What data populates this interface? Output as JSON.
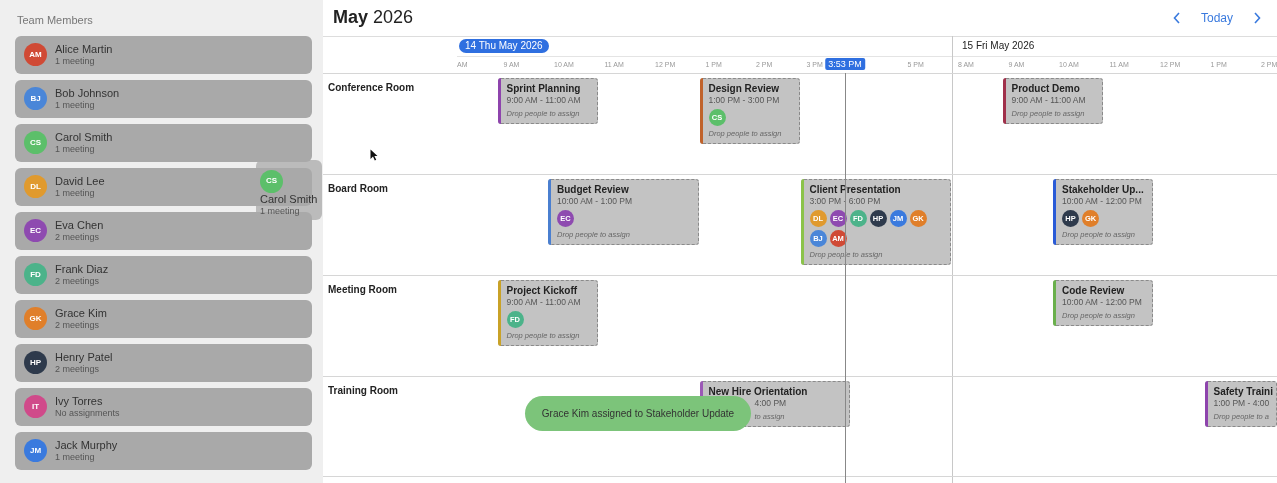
{
  "sidebar": {
    "title": "Team Members",
    "members": [
      {
        "initials": "AM",
        "name": "Alice Martin",
        "detail": "1 meeting",
        "color": "#d04a35"
      },
      {
        "initials": "BJ",
        "name": "Bob Johnson",
        "detail": "1 meeting",
        "color": "#4a86d8"
      },
      {
        "initials": "CS",
        "name": "Carol Smith",
        "detail": "1 meeting",
        "color": "#5cbf6a"
      },
      {
        "initials": "DL",
        "name": "David Lee",
        "detail": "1 meeting",
        "color": "#e09a2e"
      },
      {
        "initials": "EC",
        "name": "Eva Chen",
        "detail": "2 meetings",
        "color": "#8e4ab0"
      },
      {
        "initials": "FD",
        "name": "Frank Diaz",
        "detail": "2 meetings",
        "color": "#4cb38a"
      },
      {
        "initials": "GK",
        "name": "Grace Kim",
        "detail": "2 meetings",
        "color": "#e07f2a"
      },
      {
        "initials": "HP",
        "name": "Henry Patel",
        "detail": "2 meetings",
        "color": "#2e3a4c"
      },
      {
        "initials": "IT",
        "name": "Ivy Torres",
        "detail": "No assignments",
        "color": "#d04a8a"
      },
      {
        "initials": "JM",
        "name": "Jack Murphy",
        "detail": "1 meeting",
        "color": "#3a7ade"
      }
    ]
  },
  "drag_preview": {
    "initials": "CS",
    "name": "Carol Smith",
    "detail": "1 meeting",
    "color": "#5cbf6a"
  },
  "header": {
    "title": "**May** 2026",
    "today_label": "Today"
  },
  "days": [
    {
      "label": "14 Thu May 2026",
      "today": true,
      "hours": [
        "AM",
        "9 AM",
        "10 AM",
        "11 AM",
        "12 PM",
        "1 PM",
        "2 PM",
        "3 PM",
        "5 PM"
      ]
    },
    {
      "label": "15 Fri May 2026",
      "today": false,
      "hours": [
        "8 AM",
        "9 AM",
        "10 AM",
        "11 AM",
        "12 PM",
        "1 PM",
        "2 PM"
      ]
    }
  ],
  "now_marker": {
    "label": "3:53 PM"
  },
  "rooms": [
    {
      "name": "Conference Room",
      "days": [
        {
          "events": [
            {
              "kind": "card",
              "title": "Sprint Planning",
              "time": "9:00 AM - 11:00 AM",
              "color": "#8e44ad",
              "hint": "Drop people to assign"
            },
            {
              "kind": "card",
              "title": "Design Review",
              "time": "1:00 PM - 3:00 PM",
              "color": "#c0622b",
              "attendees": [
                {
                  "initials": "CS",
                  "color": "#5cbf6a"
                }
              ],
              "hint": "Drop people to assign"
            }
          ]
        },
        {
          "events": [
            {
              "kind": "card",
              "title": "Product Demo",
              "time": "9:00 AM - 11:00 AM",
              "color": "#a0304a",
              "hint": "Drop people to assign"
            }
          ]
        }
      ]
    },
    {
      "name": "Board Room",
      "days": [
        {
          "events": [
            {
              "kind": "card",
              "title": "Budget Review",
              "time": "10:00 AM - 1:00 PM",
              "color": "#4a7fd0",
              "attendees": [
                {
                  "initials": "EC",
                  "color": "#8e4ab0"
                }
              ],
              "hint": "Drop people to assign"
            },
            {
              "kind": "card",
              "title": "Client Presentation",
              "time": "3:00 PM - 6:00 PM",
              "color": "#8bc34a",
              "attendees": [
                {
                  "initials": "DL",
                  "color": "#e09a2e"
                },
                {
                  "initials": "EC",
                  "color": "#8e4ab0"
                },
                {
                  "initials": "FD",
                  "color": "#4cb38a"
                },
                {
                  "initials": "HP",
                  "color": "#2e3a4c"
                },
                {
                  "initials": "JM",
                  "color": "#3a7ade"
                },
                {
                  "initials": "GK",
                  "color": "#e07f2a"
                },
                {
                  "initials": "BJ",
                  "color": "#4a86d8"
                },
                {
                  "initials": "AM",
                  "color": "#d04a35"
                }
              ],
              "hint": "Drop people to assign"
            }
          ]
        },
        {
          "events": [
            {
              "kind": "card",
              "title": "Stakeholder Up...",
              "time": "10:00 AM - 12:00 PM",
              "color": "#2a5bd7",
              "attendees": [
                {
                  "initials": "HP",
                  "color": "#2e3a4c"
                },
                {
                  "initials": "GK",
                  "color": "#e07f2a"
                }
              ],
              "hint": "Drop people to assign"
            }
          ]
        }
      ]
    },
    {
      "name": "Meeting Room",
      "days": [
        {
          "events": [
            {
              "kind": "card",
              "title": "Project Kickoff",
              "time": "9:00 AM - 11:00 AM",
              "color": "#c9a227",
              "attendees": [
                {
                  "initials": "FD",
                  "color": "#4cb38a"
                }
              ],
              "hint": "Drop people to assign"
            }
          ]
        },
        {
          "events": [
            {
              "kind": "card",
              "title": "Code Review",
              "time": "10:00 AM - 12:00 PM",
              "color": "#6ab04c",
              "hint": "Drop people to assign"
            }
          ]
        }
      ]
    },
    {
      "name": "Training Room",
      "days": [
        {
          "events": [
            {
              "kind": "covered",
              "title": "New Hire Orientation",
              "time": "4:00 PM",
              "color": "#9b59b6",
              "hint": "to assign"
            }
          ]
        },
        {
          "events": [
            {
              "kind": "cut",
              "title": "Safety Traini",
              "time": "1:00 PM - 4:00",
              "color": "#8e44ad",
              "hint": "Drop people to a"
            }
          ]
        }
      ]
    }
  ],
  "toast": {
    "message": "Grace Kim assigned to Stakeholder Update"
  }
}
